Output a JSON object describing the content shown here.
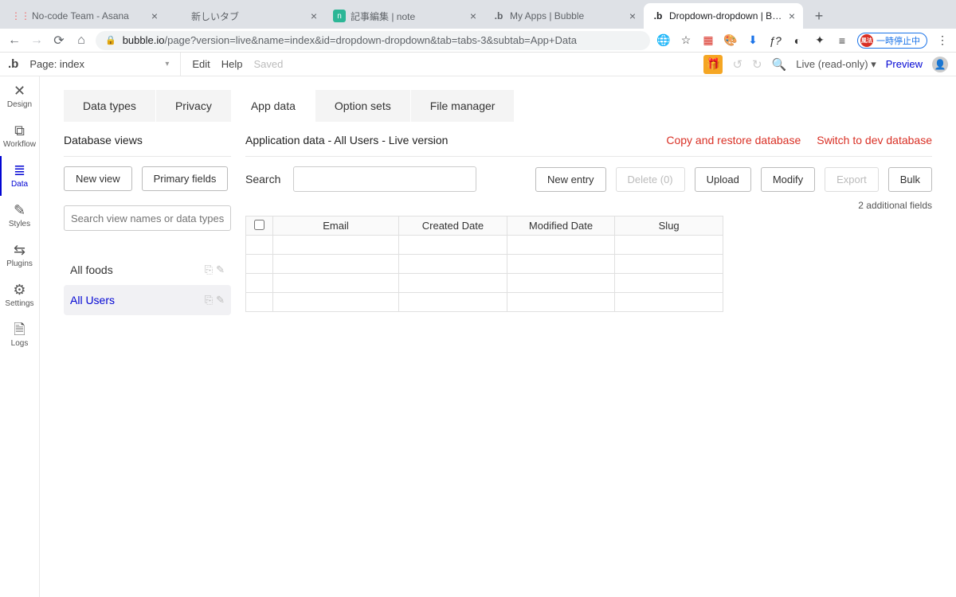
{
  "browser": {
    "tabs": [
      {
        "title": "No-code Team - Asana",
        "favicon": "⋮⋮",
        "faviconColor": "#f06a6a"
      },
      {
        "title": "新しいタブ",
        "favicon": ""
      },
      {
        "title": "記事編集 | note",
        "favicon": "n",
        "faviconColor": "#2cb696"
      },
      {
        "title": "My Apps | Bubble",
        "favicon": "b",
        "faviconColor": "#111"
      },
      {
        "title": "Dropdown-dropdown | Bubble",
        "favicon": "b",
        "faviconColor": "#111",
        "active": true
      }
    ],
    "url_host": "bubble.io",
    "url_path": "/page?version=live&name=index&id=dropdown-dropdown&tab=tabs-3&subtab=App+Data",
    "pill": "一時停止中",
    "pill_badge": "風法"
  },
  "header": {
    "page_label": "Page: index",
    "edit": "Edit",
    "help": "Help",
    "saved": "Saved",
    "live": "Live (read-only)",
    "preview": "Preview"
  },
  "leftnav": [
    {
      "label": "Design",
      "icon": "✕"
    },
    {
      "label": "Workflow",
      "icon": "⧇"
    },
    {
      "label": "Data",
      "icon": "≣",
      "active": true
    },
    {
      "label": "Styles",
      "icon": "✎"
    },
    {
      "label": "Plugins",
      "icon": "⇆"
    },
    {
      "label": "Settings",
      "icon": "⚙"
    },
    {
      "label": "Logs",
      "icon": "🗎"
    }
  ],
  "subtabs": [
    {
      "label": "Data types"
    },
    {
      "label": "Privacy"
    },
    {
      "label": "App data",
      "active": true
    },
    {
      "label": "Option sets"
    },
    {
      "label": "File manager"
    }
  ],
  "left": {
    "heading": "Database views",
    "new_view": "New view",
    "primary_fields": "Primary fields",
    "filter_placeholder": "Search view names or data types...",
    "views": [
      {
        "label": "All foods"
      },
      {
        "label": "All Users",
        "active": true
      }
    ]
  },
  "right": {
    "heading": "Application data - All Users - Live version",
    "link_copy": "Copy and restore database",
    "link_switch": "Switch to dev database",
    "search": "Search",
    "new_entry": "New entry",
    "delete": "Delete (0)",
    "upload": "Upload",
    "modify": "Modify",
    "export": "Export",
    "bulk": "Bulk",
    "additional": "2 additional fields",
    "columns": [
      "",
      "Email",
      "Created Date",
      "Modified Date",
      "Slug"
    ]
  }
}
